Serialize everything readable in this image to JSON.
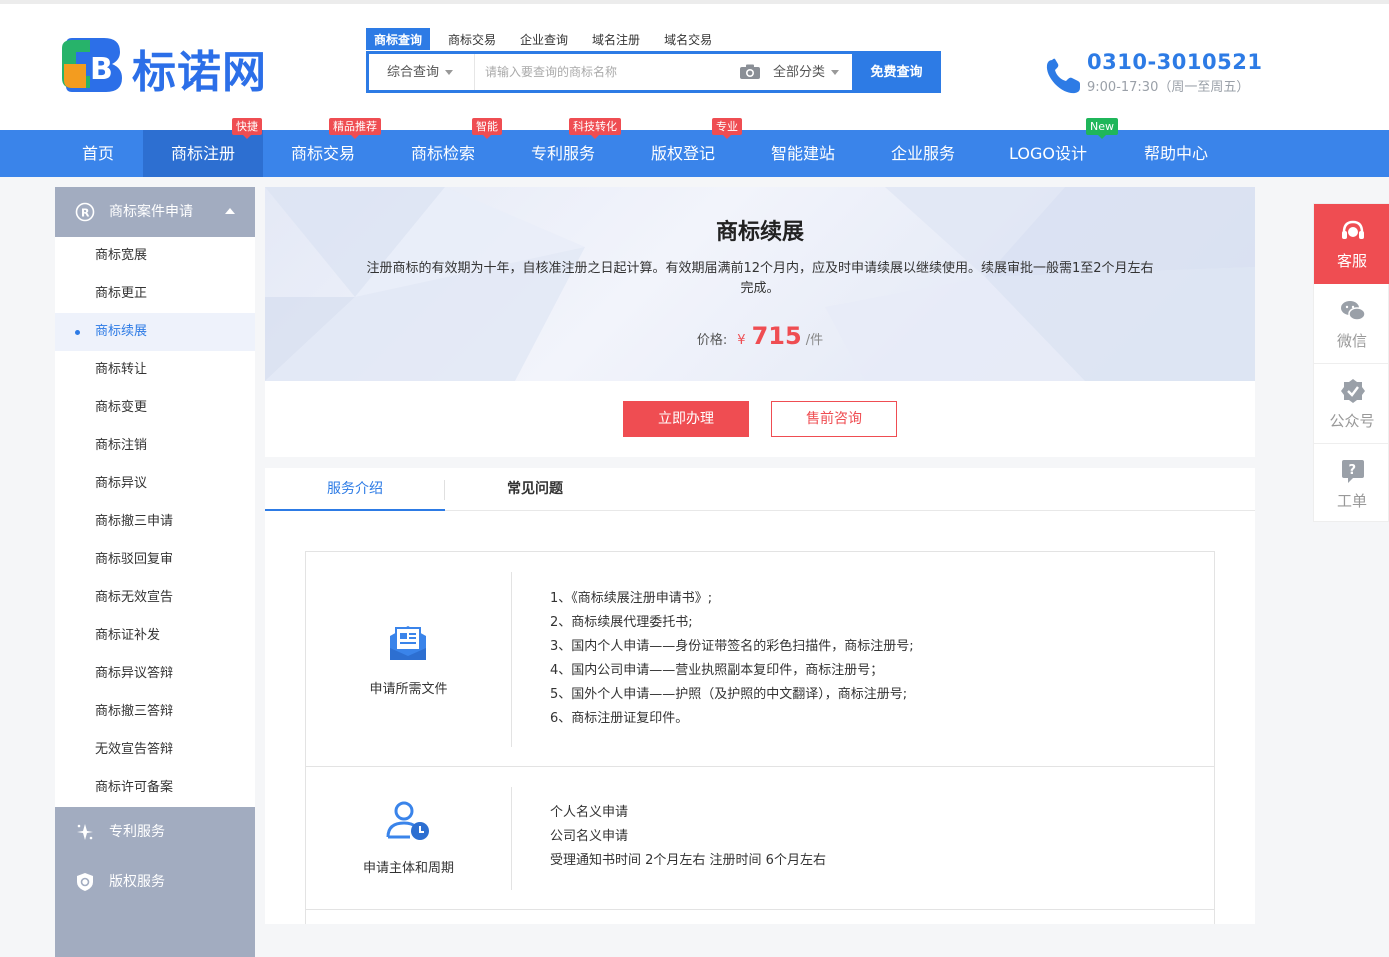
{
  "logo": {
    "text": "标诺网"
  },
  "search": {
    "tabs": [
      "商标查询",
      "商标交易",
      "企业查询",
      "域名注册",
      "域名交易"
    ],
    "type_select": "综合查询",
    "placeholder": "请输入要查询的商标名称",
    "category_select": "全部分类",
    "button": "免费查询"
  },
  "contact": {
    "phone": "0310-3010521",
    "hours": "9:00-17:30（周一至周五）"
  },
  "nav": {
    "items": [
      {
        "label": "首页"
      },
      {
        "label": "商标注册",
        "badge": "快捷"
      },
      {
        "label": "商标交易",
        "badge": "精品推荐"
      },
      {
        "label": "商标检索",
        "badge": "智能"
      },
      {
        "label": "专利服务",
        "badge": "科技转化"
      },
      {
        "label": "版权登记",
        "badge": "专业"
      },
      {
        "label": "智能建站"
      },
      {
        "label": "企业服务"
      },
      {
        "label": "LOGO设计",
        "badge": "New"
      },
      {
        "label": "帮助中心"
      }
    ]
  },
  "sidebar": {
    "header": "商标案件申请",
    "items": [
      "商标宽展",
      "商标更正",
      "商标续展",
      "商标转让",
      "商标变更",
      "商标注销",
      "商标异议",
      "商标撤三申请",
      "商标驳回复审",
      "商标无效宣告",
      "商标证补发",
      "商标异议答辩",
      "商标撤三答辩",
      "无效宣告答辩",
      "商标许可备案"
    ],
    "active_index": 2,
    "sections": [
      "专利服务",
      "版权服务"
    ]
  },
  "banner": {
    "title": "商标续展",
    "description": "注册商标的有效期为十年，自核准注册之日起计算。有效期届满前12个月内，应及时申请续展以继续使用。续展审批一般需1至2个月左右完成。",
    "price_label": "价格:",
    "currency": "¥",
    "price": "715",
    "unit": "/件"
  },
  "actions": {
    "primary": "立即办理",
    "secondary": "售前咨询"
  },
  "tabs": [
    "服务介绍",
    "常见问题"
  ],
  "details": [
    {
      "label": "申请所需文件",
      "icon": "document-icon",
      "lines": [
        "1、《商标续展注册申请书》;",
        "2、商标续展代理委托书;",
        "3、国内个人申请——身份证带签名的彩色扫描件，商标注册号;",
        "4、国内公司申请——营业执照副本复印件，商标注册号；",
        "5、国外个人申请——护照（及护照的中文翻译），商标注册号;",
        "6、商标注册证复印件。"
      ]
    },
    {
      "label": "申请主体和周期",
      "icon": "user-clock-icon",
      "lines": [
        "个人名义申请",
        "公司名义申请",
        "受理通知书时间 2个月左右 注册时间 6个月左右"
      ]
    }
  ],
  "float_bar": [
    "客服",
    "微信",
    "公众号",
    "工单"
  ],
  "colors": {
    "primary": "#3a84ea",
    "accent": "#ef4d52",
    "sidebar_header": "#a2acc0"
  }
}
